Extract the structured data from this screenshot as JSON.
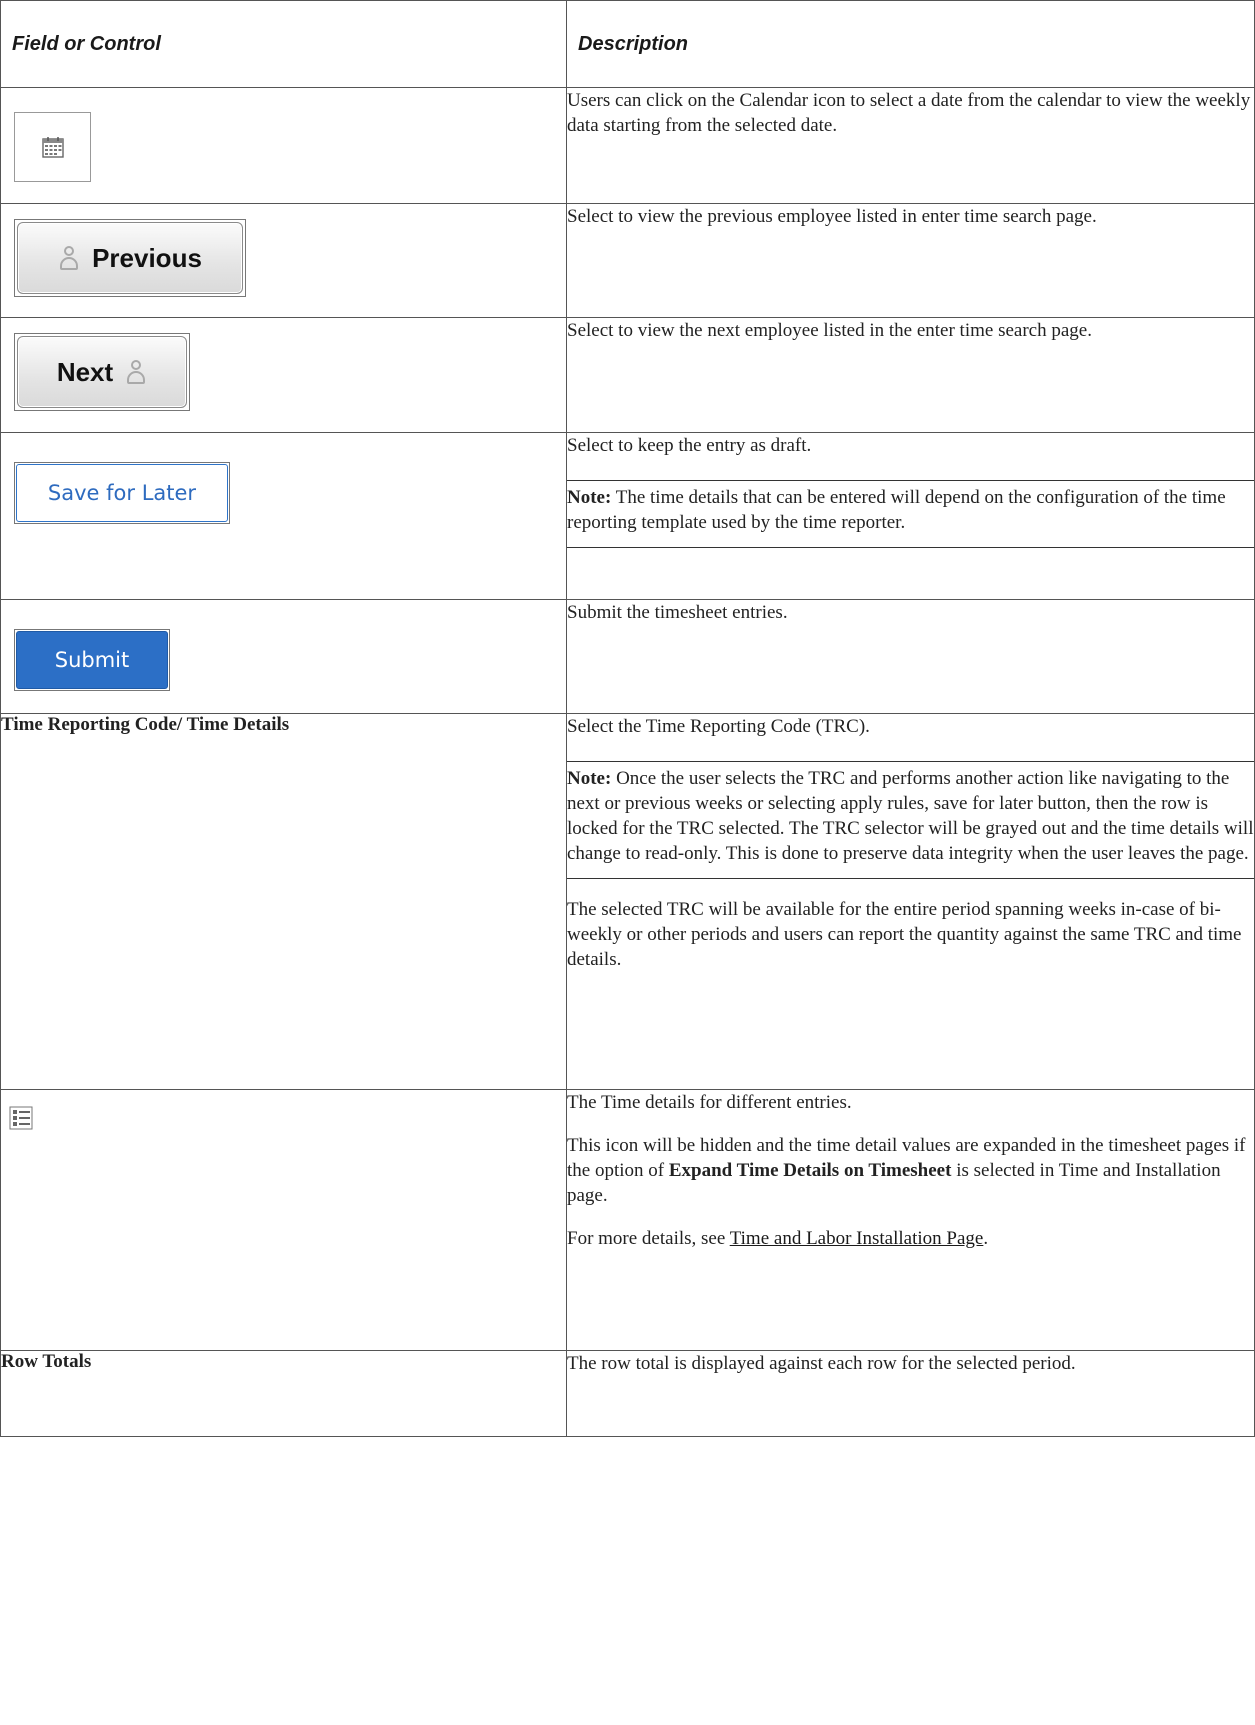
{
  "header": {
    "col1": "Field or Control",
    "col2": "Description"
  },
  "rows": {
    "calendar": {
      "icon": "calendar-icon",
      "description": "Users can click on the Calendar icon to select a date from the calendar to view the weekly data starting from the selected date."
    },
    "previous": {
      "label": "Previous",
      "icon": "person-icon",
      "description": "Select to view the previous employee listed in enter time search page."
    },
    "next": {
      "label": "Next",
      "icon": "person-icon",
      "description": "Select to view the next employee listed in the enter time search page."
    },
    "save": {
      "label": "Save for Later",
      "description": "Select to keep the entry as draft.",
      "note_label": "Note:",
      "note_text": " The time details that can be entered will depend on the configuration of the time reporting template used by the time reporter."
    },
    "submit": {
      "label": "Submit",
      "description": "Submit the timesheet entries."
    },
    "trc": {
      "label": "Time Reporting Code/ Time Details",
      "description": "Select the Time Reporting Code (TRC).",
      "note_label": "Note:",
      "note_text": " Once the user selects the TRC and performs another action like navigating to the next or previous weeks or selecting apply rules, save for later button, then the row is locked for the TRC selected. The TRC selector will be grayed out and the time details will change to read-only. This is done to preserve data integrity when the user leaves the page.",
      "description2": "The selected TRC will be available for the entire period spanning weeks in-case of bi-weekly or other periods and users can report the quantity against the same TRC and time details."
    },
    "details": {
      "icon": "list-details-icon",
      "description": "The Time details for different entries.",
      "para2_a": "This icon will be hidden and the time detail values are expanded in the timesheet pages if the option of ",
      "para2_bold": "Expand Time Details on Timesheet",
      "para2_b": " is selected in Time and Installation page.",
      "para3_a": "For more details, see ",
      "para3_link": "Time and Labor Installation Page",
      "para3_b": "."
    },
    "totals": {
      "label": "Row Totals",
      "description": "The row total is displayed against each row for the selected period."
    }
  },
  "colors": {
    "accent_blue": "#2c6fc6",
    "border": "#555555"
  }
}
